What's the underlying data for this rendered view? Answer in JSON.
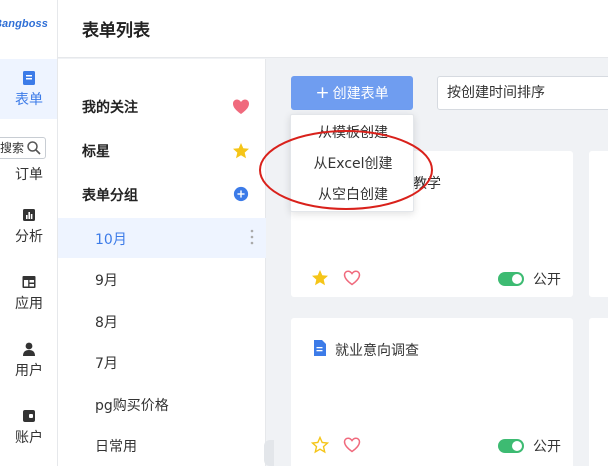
{
  "app": {
    "logo_text": "Bangboss",
    "page_title": "表单列表"
  },
  "rail": {
    "items": [
      {
        "label": "表单",
        "icon": "form-icon",
        "active": true
      },
      {
        "label": "分析",
        "icon": "chart-icon"
      },
      {
        "label": "应用",
        "icon": "app-icon"
      },
      {
        "label": "用户",
        "icon": "user-icon"
      },
      {
        "label": "账户",
        "icon": "wallet-icon"
      }
    ],
    "search_text": "搜索",
    "order_label": "订单"
  },
  "side": {
    "follow_label": "我的关注",
    "star_label": "标星",
    "groups_label": "表单分组",
    "groups": [
      "10月",
      "9月",
      "8月",
      "7月",
      "pg购买价格",
      "日常用"
    ],
    "active_group": "10月"
  },
  "toolbar": {
    "create_label": "创建表单",
    "sort_label": "按创建时间排序"
  },
  "menu": {
    "items": [
      "从模板创建",
      "从Excel创建",
      "从空白创建"
    ]
  },
  "cards": [
    {
      "title": "教学",
      "starred": true,
      "status": "公开"
    },
    {
      "title": "就业意向调查",
      "starred": false,
      "status": "公开"
    }
  ],
  "colors": {
    "accent": "#3c7be8",
    "button": "#6f9df0",
    "toggle_on": "#3dbb72",
    "heart": "#f06a7d",
    "star": "#f5c518",
    "annotation": "#d9211b"
  }
}
